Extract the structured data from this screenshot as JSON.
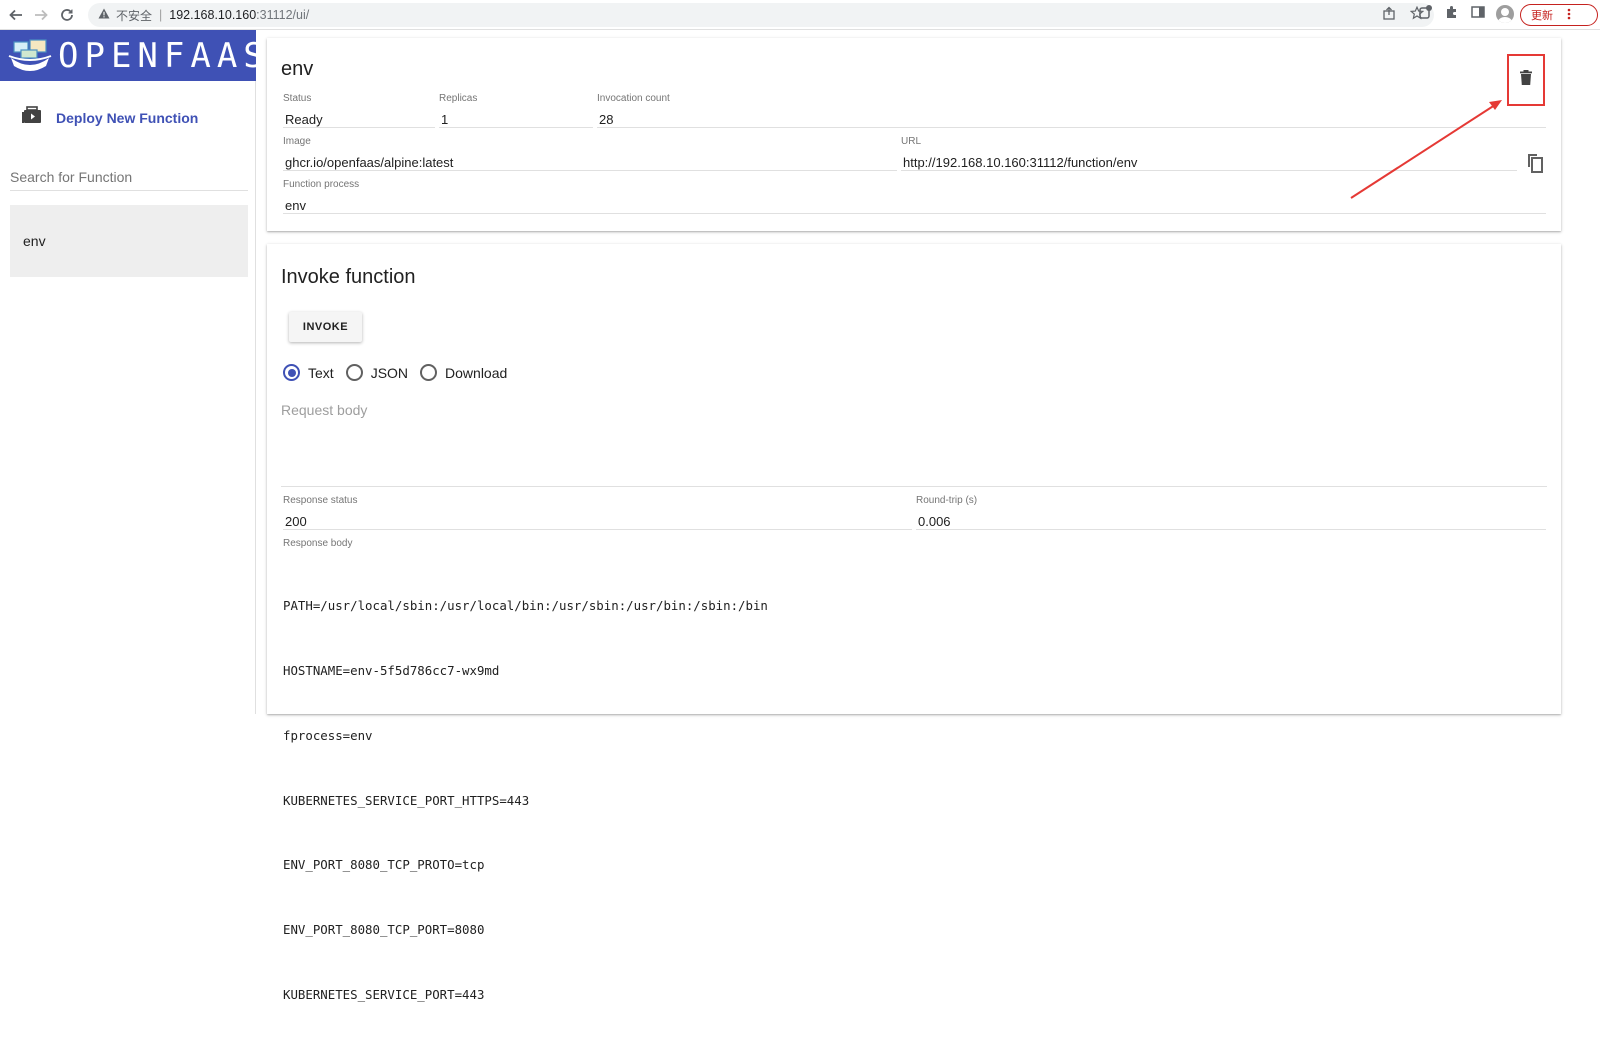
{
  "browser": {
    "insecure_label": "不安全",
    "url_host": "192.168.10.160",
    "url_path": ":31112/ui/",
    "update_label": "更新"
  },
  "sidebar": {
    "logo_text": "OPENFAAS",
    "deploy_label": "Deploy New Function",
    "search_placeholder": "Search for Function",
    "functions": [
      "env"
    ]
  },
  "function": {
    "name": "env",
    "fields": {
      "status": {
        "label": "Status",
        "value": "Ready"
      },
      "replicas": {
        "label": "Replicas",
        "value": "1"
      },
      "invocation_count": {
        "label": "Invocation count",
        "value": "28"
      },
      "image": {
        "label": "Image",
        "value": "ghcr.io/openfaas/alpine:latest"
      },
      "url": {
        "label": "URL",
        "value": "http://192.168.10.160:31112/function/env"
      },
      "process": {
        "label": "Function process",
        "value": "env"
      }
    }
  },
  "invoke": {
    "title": "Invoke function",
    "button_label": "INVOKE",
    "response_types": [
      {
        "label": "Text",
        "checked": true
      },
      {
        "label": "JSON",
        "checked": false
      },
      {
        "label": "Download",
        "checked": false
      }
    ],
    "request_placeholder": "Request body",
    "response_status": {
      "label": "Response status",
      "value": "200"
    },
    "round_trip": {
      "label": "Round-trip (s)",
      "value": "0.006"
    },
    "response_body_label": "Response body",
    "response_body": [
      "PATH=/usr/local/sbin:/usr/local/bin:/usr/sbin:/usr/bin:/sbin:/bin",
      "HOSTNAME=env-5f5d786cc7-wx9md",
      "fprocess=env",
      "KUBERNETES_SERVICE_PORT_HTTPS=443",
      "ENV_PORT_8080_TCP_PROTO=tcp",
      "ENV_PORT_8080_TCP_PORT=8080",
      "KUBERNETES_SERVICE_PORT=443"
    ]
  },
  "colors": {
    "brand": "#3f51b5",
    "annotation": "#e53935"
  }
}
